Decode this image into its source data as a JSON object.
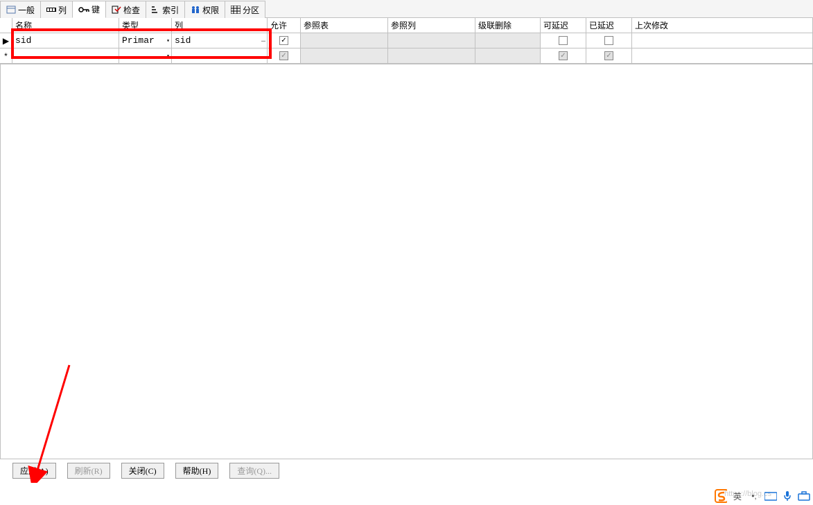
{
  "tabs": [
    {
      "label": "一般"
    },
    {
      "label": "列"
    },
    {
      "label": "键",
      "active": true
    },
    {
      "label": "检查"
    },
    {
      "label": "索引"
    },
    {
      "label": "权限"
    },
    {
      "label": "分区"
    }
  ],
  "table": {
    "headers": {
      "name": "名称",
      "type": "类型",
      "col": "列",
      "allow": "允许",
      "reftab": "参照表",
      "refcol": "参照列",
      "cascade": "级联删除",
      "defer": "可延迟",
      "deferred": "已延迟",
      "lastmod": "上次修改"
    },
    "rows": [
      {
        "marker": "▶",
        "name": "sid",
        "type": "Primar",
        "col": "sid",
        "allow_checked": true
      },
      {
        "marker": "*",
        "name": "",
        "type": "",
        "col": "",
        "allow_checked": true
      }
    ]
  },
  "buttons": {
    "apply": "应用(A)",
    "refresh": "刷新(R)",
    "close": "关闭(C)",
    "help": "帮助(H)",
    "query": "查询(Q)..."
  },
  "corner": {
    "ime": "英",
    "punct": "•,"
  },
  "watermark": "https://blog.cs"
}
